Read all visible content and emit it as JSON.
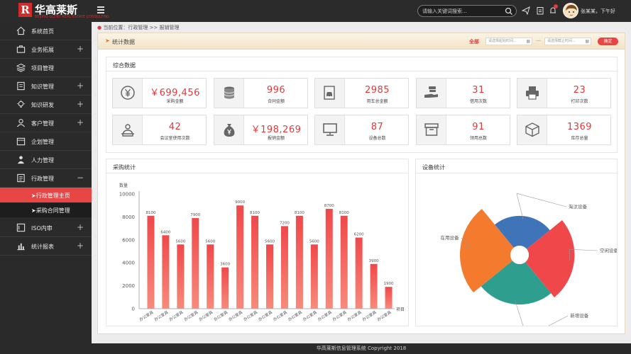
{
  "app": {
    "logo_mark": "R",
    "logo_name": "华高莱斯",
    "logo_sub": "BEIJING GLORY REAL ESTATE CONSULTING"
  },
  "topbar": {
    "search_placeholder": "请输入关键词搜索...",
    "user_greeting": "张某某，下午好"
  },
  "sidebar": {
    "items": [
      {
        "label": "系统首页",
        "icon": "home-icon",
        "expandable": false
      },
      {
        "label": "业务拓展",
        "icon": "briefcase-icon",
        "expandable": true
      },
      {
        "label": "项目管理",
        "icon": "layers-icon",
        "expandable": false
      },
      {
        "label": "知识管理",
        "icon": "book-icon",
        "expandable": true
      },
      {
        "label": "知识研发",
        "icon": "lightbulb-icon",
        "expandable": true
      },
      {
        "label": "客户管理",
        "icon": "user-icon",
        "expandable": true
      },
      {
        "label": "企划管理",
        "icon": "calendar-icon",
        "expandable": false
      },
      {
        "label": "人力管理",
        "icon": "person-icon",
        "expandable": false
      },
      {
        "label": "行政管理",
        "icon": "document-icon",
        "expandable": true,
        "expanded": true
      },
      {
        "label": "ISO内审",
        "icon": "iso-icon",
        "expandable": true
      },
      {
        "label": "统计报表",
        "icon": "bar-chart-icon",
        "expandable": true
      }
    ],
    "sub_items": [
      {
        "label": "➤行政管理主页",
        "active": true
      },
      {
        "label": "➤采购合同管理",
        "active": false
      }
    ]
  },
  "breadcrumb": "当前位置：行政管理 >> 报销管理",
  "header": {
    "title": "统计数据",
    "all_label": "全部",
    "start_placeholder": "请选择起始时间...",
    "end_placeholder": "请选择截止时间...",
    "separator": "—",
    "confirm_label": "确定"
  },
  "summary": {
    "title": "综合数据",
    "cards": [
      {
        "value": "￥699,456",
        "label": "采购金额",
        "icon": "yen-coin-icon"
      },
      {
        "value": "996",
        "label": "合同金额",
        "icon": "coin-stack-icon"
      },
      {
        "value": "2985",
        "label": "用车总金额",
        "icon": "car-receipt-icon"
      },
      {
        "value": "31",
        "label": "借用次数",
        "icon": "hand-give-icon"
      },
      {
        "value": "23",
        "label": "打印次数",
        "icon": "printer-icon"
      },
      {
        "value": "42",
        "label": "会议室使用次数",
        "icon": "meeting-icon"
      },
      {
        "value": "￥198,269",
        "label": "报销金额",
        "icon": "money-bag-icon"
      },
      {
        "value": "87",
        "label": "设备总数",
        "icon": "monitor-icon"
      },
      {
        "value": "91",
        "label": "领用总数",
        "icon": "box-icon"
      },
      {
        "value": "1369",
        "label": "库存总量",
        "icon": "cube-icon"
      }
    ]
  },
  "purchase_panel": {
    "title": "采购统计"
  },
  "device_panel": {
    "title": "设备统计"
  },
  "chart_data": [
    {
      "type": "bar",
      "ylabel": "数量",
      "xlabel": "项目",
      "ylim": [
        0,
        10000
      ],
      "yticks": [
        0,
        2000,
        4000,
        6000,
        8000,
        10000
      ],
      "grid": false,
      "categories": [
        "办公家具",
        "办公家具",
        "办公家具",
        "办公家具",
        "办公家具",
        "办公家具",
        "办公家具",
        "办公家具",
        "办公家具",
        "办公家具",
        "办公家具",
        "办公家具",
        "办公家具",
        "办公家具",
        "办公家具",
        "办公家具",
        "办公家具"
      ],
      "values": [
        8100,
        6400,
        5600,
        7900,
        5600,
        3600,
        9000,
        8100,
        5600,
        7200,
        8100,
        5600,
        8700,
        8100,
        6200,
        3900,
        1900
      ],
      "color": "#f0484a"
    },
    {
      "type": "pie",
      "rose": true,
      "slices": [
        {
          "name": "淘汰设备",
          "value": 30,
          "color": "#3f74b8"
        },
        {
          "name": "空闲设备",
          "value": 70,
          "color": "#f0484a"
        },
        {
          "name": "新增设备",
          "value": 55,
          "color": "#2e9e8e"
        },
        {
          "name": "在用设备",
          "value": 85,
          "color": "#f47b2e"
        }
      ]
    }
  ],
  "footer": "华高莱斯信息管理系统   Copyright  2018"
}
